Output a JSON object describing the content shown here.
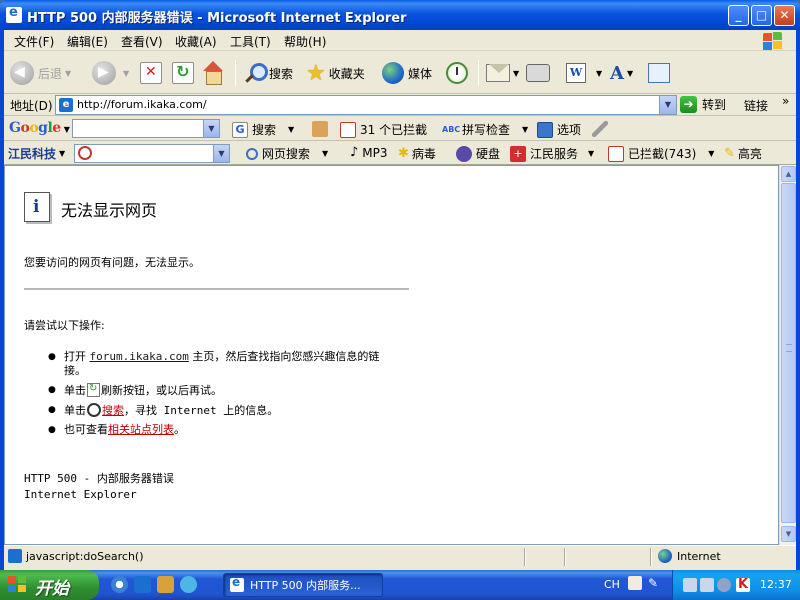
{
  "window": {
    "title": "HTTP 500 内部服务器错误 - Microsoft Internet Explorer"
  },
  "menu": [
    "文件(F)",
    "编辑(E)",
    "查看(V)",
    "收藏(A)",
    "工具(T)",
    "帮助(H)"
  ],
  "toolbar": {
    "back": "后退",
    "search": "搜索",
    "favorites": "收藏夹",
    "media": "媒体"
  },
  "address": {
    "label": "地址(D)",
    "url": "http://forum.ikaka.com/",
    "go": "转到",
    "links": "链接",
    "more": "»"
  },
  "google_bar": {
    "logo": [
      "G",
      "o",
      "o",
      "g",
      "l",
      "e"
    ],
    "search": "搜索",
    "blocked": "31 个已拦截",
    "spellcheck": "拼写检查",
    "options": "选项"
  },
  "jiangmin_bar": {
    "brand": "江民科技",
    "web_search": "网页搜索",
    "mp3": "MP3",
    "virus": "病毒",
    "disk": "硬盘",
    "service": "江民服务",
    "blocked": "已拦截(743)",
    "highlight": "高亮"
  },
  "page": {
    "heading": "无法显示网页",
    "desc": "您要访问的网页有问题，无法显示。",
    "try_heading": "请尝试以下操作:",
    "tip1_pre": "打开 ",
    "tip1_link": "forum.ikaka.com",
    "tip1_post": " 主页，然后查找指向您感兴趣信息的链接。",
    "tip2_pre": "单击",
    "tip2_post": "刷新按钮，或以后再试。",
    "tip3_pre": "单击",
    "tip3_link": "搜索",
    "tip3_post": "，寻找 Internet 上的信息。",
    "tip4_pre": "也可查看",
    "tip4_link": "相关站点列表",
    "tip4_post": "。",
    "footer_line1": "HTTP 500 - 内部服务器错误",
    "footer_line2": "Internet Explorer"
  },
  "status": {
    "text": "javascript:doSearch()",
    "zone": "Internet"
  },
  "taskbar": {
    "start": "开始",
    "task": "HTTP 500 内部服务...",
    "lang": "CH",
    "clock": "12:37"
  },
  "colors": {
    "titlebar": "#0054e3",
    "link_red": "#c00000",
    "start_green": "#3c9a3c"
  }
}
